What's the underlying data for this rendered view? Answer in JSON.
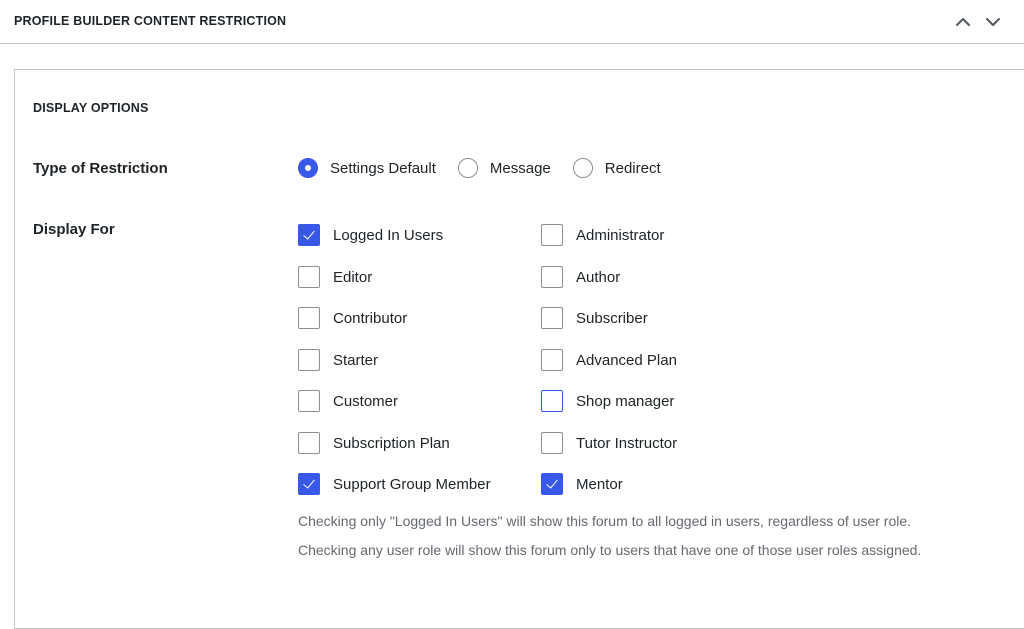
{
  "header": {
    "title": "PROFILE BUILDER CONTENT RESTRICTION",
    "move_up_icon": "chevron-up-icon",
    "move_down_icon": "chevron-down-icon"
  },
  "section": {
    "title": "DISPLAY OPTIONS"
  },
  "restriction": {
    "label": "Type of Restriction",
    "options": [
      {
        "label": "Settings Default",
        "checked": true
      },
      {
        "label": "Message",
        "checked": false
      },
      {
        "label": "Redirect",
        "checked": false
      }
    ]
  },
  "display_for": {
    "label": "Display For",
    "items": [
      {
        "label": "Logged In Users",
        "checked": true
      },
      {
        "label": "Administrator",
        "checked": false
      },
      {
        "label": "Editor",
        "checked": false
      },
      {
        "label": "Author",
        "checked": false
      },
      {
        "label": "Contributor",
        "checked": false
      },
      {
        "label": "Subscriber",
        "checked": false
      },
      {
        "label": "Starter",
        "checked": false
      },
      {
        "label": "Advanced Plan",
        "checked": false
      },
      {
        "label": "Customer",
        "checked": false
      },
      {
        "label": "Shop manager",
        "checked": false,
        "focused": true
      },
      {
        "label": "Subscription Plan",
        "checked": false
      },
      {
        "label": "Tutor Instructor",
        "checked": false
      },
      {
        "label": "Support Group Member",
        "checked": true
      },
      {
        "label": "Mentor",
        "checked": true
      }
    ],
    "help_1": "Checking only \"Logged In Users\" will show this forum to all logged in users, regardless of user role.",
    "help_2": "Checking any user role will show this forum only to users that have one of those user roles assigned."
  },
  "colors": {
    "accent": "#3858e9",
    "border": "#c3c4c7",
    "text": "#1d2327",
    "muted": "#646970"
  }
}
